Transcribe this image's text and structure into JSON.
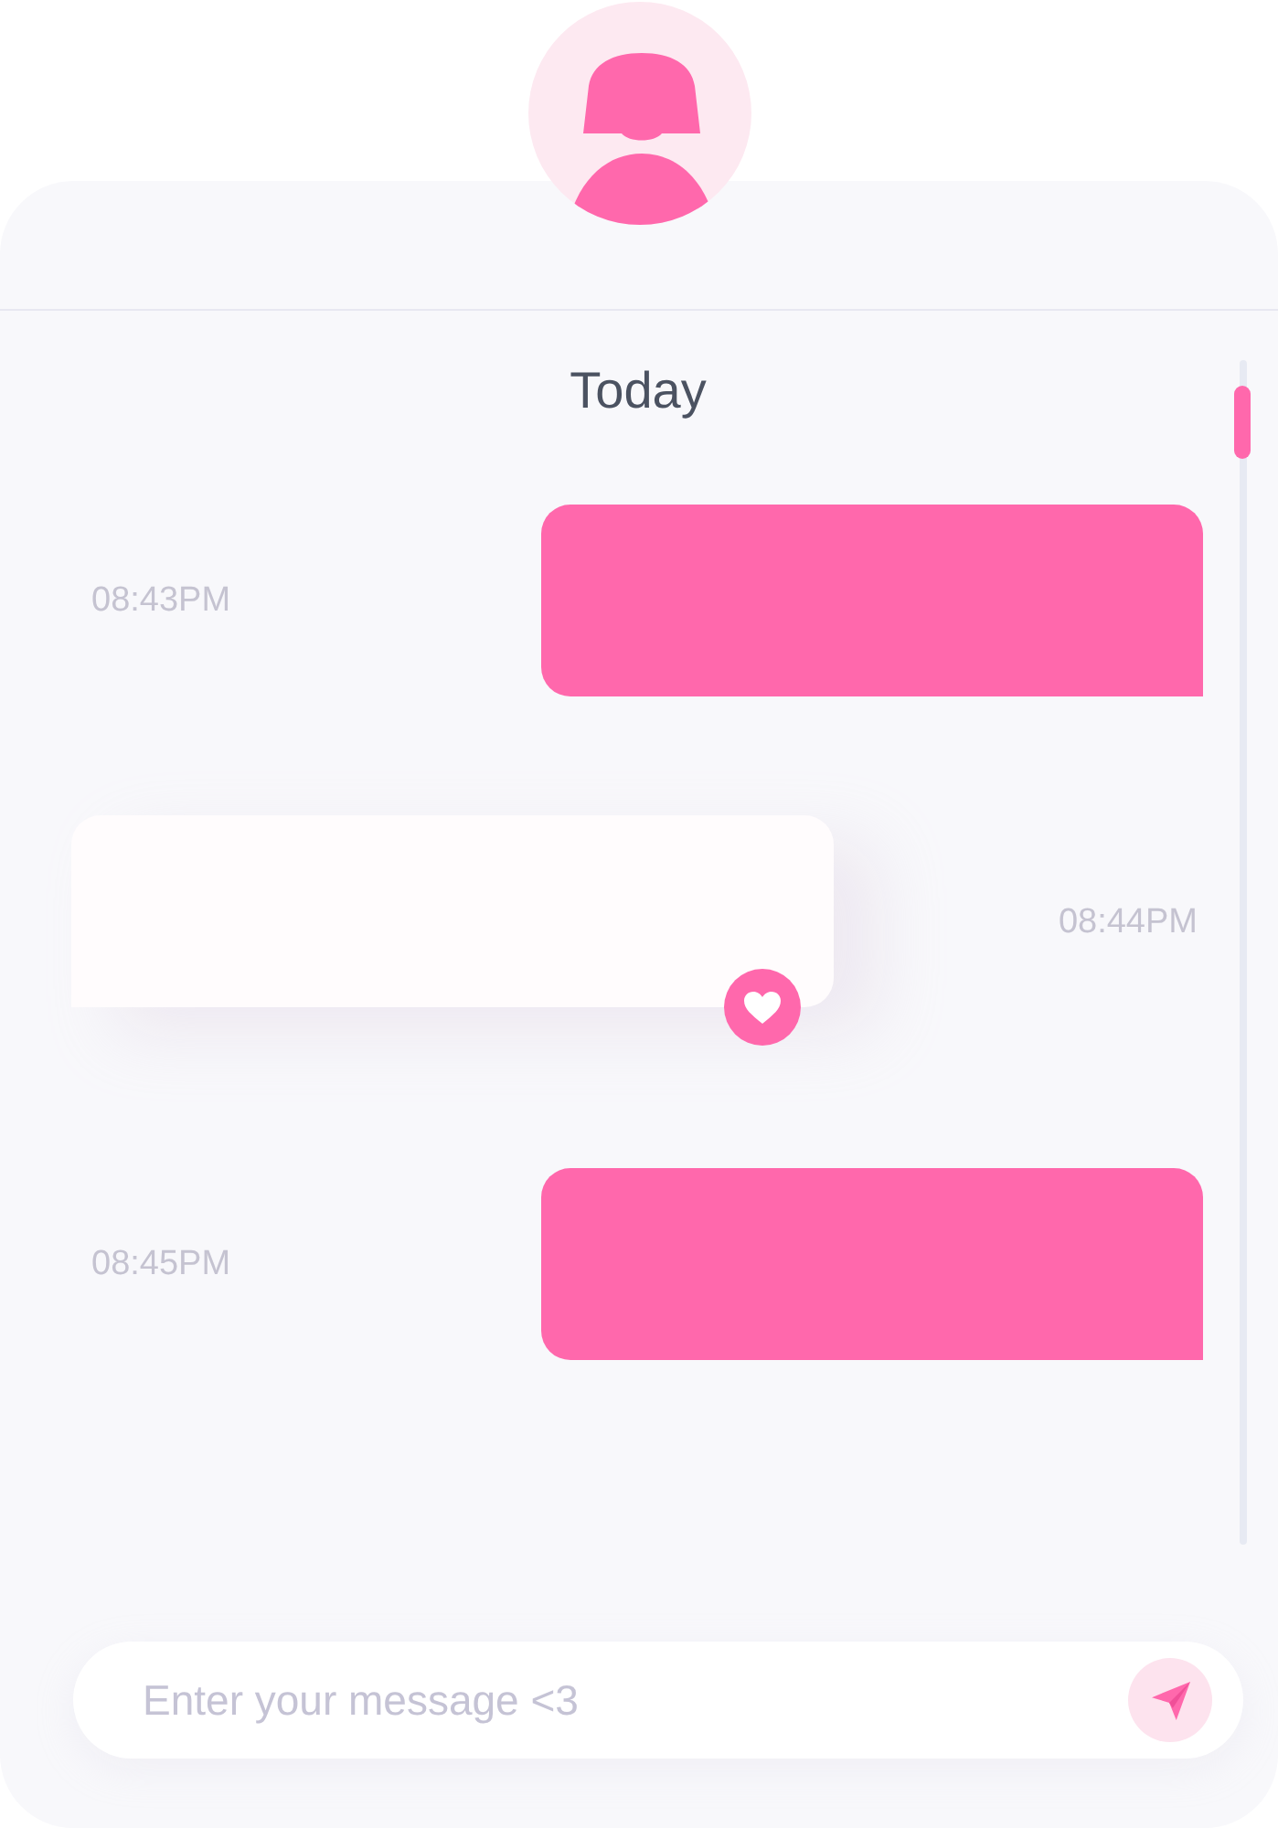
{
  "chat": {
    "date_label": "Today",
    "messages": [
      {
        "kind": "sent",
        "time": "08:43PM",
        "liked": false
      },
      {
        "kind": "received",
        "time": "08:44PM",
        "liked": true
      },
      {
        "kind": "sent",
        "time": "08:45PM",
        "liked": false
      }
    ]
  },
  "composer": {
    "placeholder": "Enter your message <3"
  }
}
